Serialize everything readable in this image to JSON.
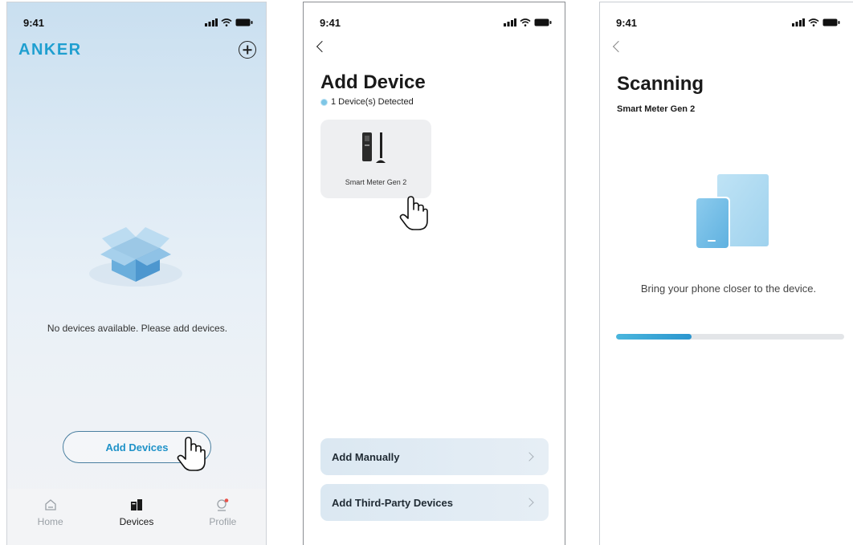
{
  "status_bar": {
    "time": "9:41"
  },
  "screen1": {
    "logo": "ANKER",
    "empty_message": "No devices available. Please add devices.",
    "add_button": "Add Devices",
    "tabs": [
      {
        "label": "Home",
        "icon": "home-icon"
      },
      {
        "label": "Devices",
        "icon": "devices-icon"
      },
      {
        "label": "Profile",
        "icon": "profile-icon"
      }
    ]
  },
  "screen2": {
    "title": "Add Device",
    "detected": "1 Device(s) Detected",
    "device_name": "Smart Meter Gen 2",
    "actions": [
      "Add Manually",
      "Add Third-Party Devices"
    ]
  },
  "screen3": {
    "title": "Scanning",
    "subtitle": "Smart Meter Gen 2",
    "hint": "Bring your phone closer to the device.",
    "progress": 0.33
  },
  "colors": {
    "accent": "#1f9fd0",
    "progress": "#2b96cf"
  }
}
